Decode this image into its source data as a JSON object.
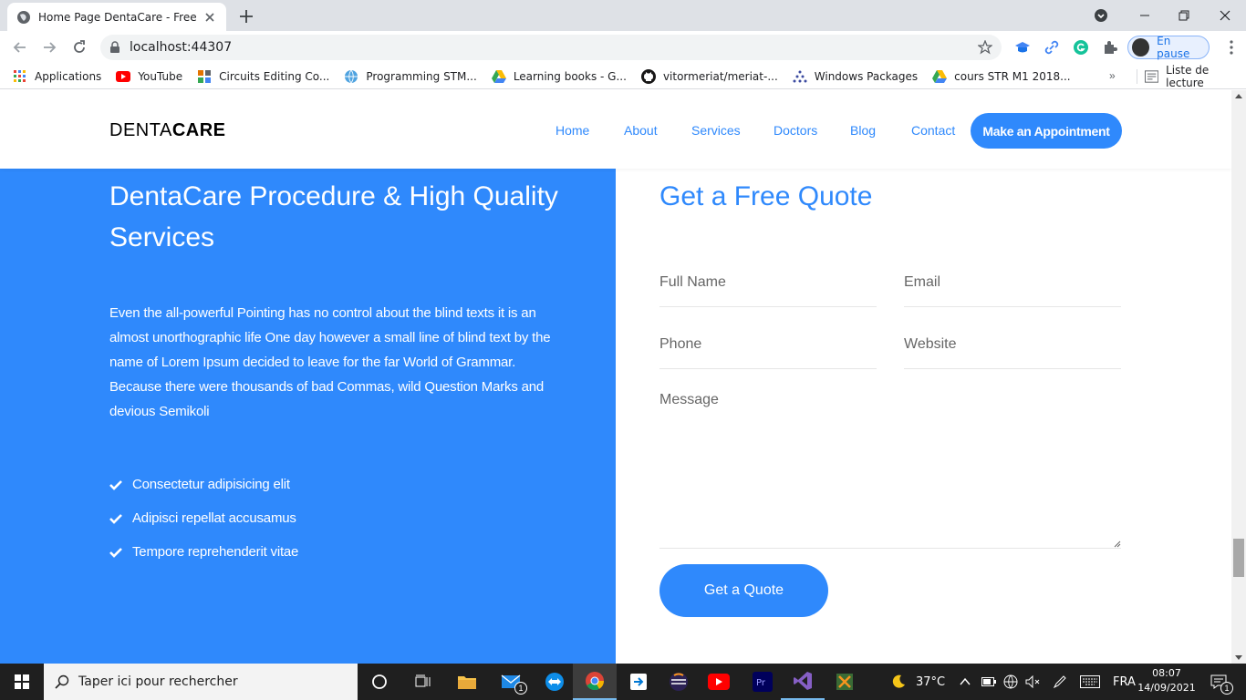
{
  "browser": {
    "tab_title": "Home Page DentaCare - Free Bo",
    "url": "localhost:44307",
    "profile_label": "En pause"
  },
  "bookmarks": {
    "items": [
      {
        "label": "Applications",
        "icon": "apps-grid-icon"
      },
      {
        "label": "YouTube",
        "icon": "youtube-icon"
      },
      {
        "label": "Circuits Editing Co...",
        "icon": "circuits-icon"
      },
      {
        "label": "Programming STM...",
        "icon": "globe-icon"
      },
      {
        "label": "Learning books - G...",
        "icon": "drive-icon"
      },
      {
        "label": "vitormeriat/meriat-...",
        "icon": "github-icon"
      },
      {
        "label": "Windows Packages",
        "icon": "packages-icon"
      },
      {
        "label": "cours STR M1 2018...",
        "icon": "drive-icon"
      }
    ],
    "more": "»",
    "reading_list": "Liste de lecture"
  },
  "site": {
    "brand_light": "DENTA",
    "brand_bold": "CARE",
    "nav": [
      "Home",
      "About",
      "Services",
      "Doctors",
      "Blog",
      "Contact"
    ],
    "appointment_button": "Make an Appointment",
    "left": {
      "title": "DentaCare Procedure & High Quality Services",
      "paragraph": "Even the all-powerful Pointing has no control about the blind texts it is an almost unorthographic life One day however a small line of blind text by the name of Lorem Ipsum decided to leave for the far World of Grammar. Because there were thousands of bad Commas, wild Question Marks and devious Semikoli",
      "checklist": [
        "Consectetur adipisicing elit",
        "Adipisci repellat accusamus",
        "Tempore reprehenderit vitae"
      ]
    },
    "right": {
      "title": "Get a Free Quote",
      "placeholders": {
        "full_name": "Full Name",
        "email": "Email",
        "phone": "Phone",
        "website": "Website",
        "message": "Message"
      },
      "submit": "Get a Quote"
    },
    "colors": {
      "primary": "#2f89fc",
      "white": "#ffffff"
    }
  },
  "taskbar": {
    "search_placeholder": "Taper ici pour rechercher",
    "weather": "37°C",
    "language": "FRA",
    "time": "08:07",
    "date": "14/09/2021",
    "mail_badge": "1",
    "notif_badge": "1"
  }
}
